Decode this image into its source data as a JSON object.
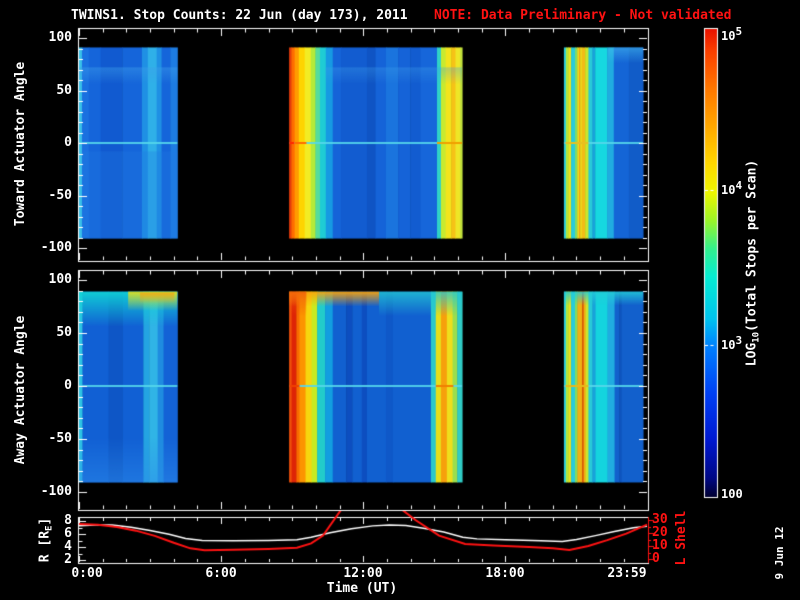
{
  "title": {
    "main": "TWINS1. Stop Counts: 22 Jun (day 173), 2011",
    "note": "NOTE: Data Preliminary - Not validated"
  },
  "stamp": "9 Jun 12",
  "colors": {
    "bg": "#000000",
    "axis": "#ffffff",
    "note_red": "#ff1212",
    "lshell_red": "#ff1212",
    "hline_cyan": "rgba(85,215,235,0.9)"
  },
  "axes": {
    "panel1_label": "Toward Actuator Angle",
    "panel2_label": "Away Actuator Angle",
    "r_label_pre": "R [R",
    "r_label_sub": "E",
    "r_label_post": "]",
    "lshell_label": "L Shell",
    "time_label": "Time (UT)",
    "panel_yticks": [
      "100",
      "50",
      "0",
      "-50",
      "-100"
    ],
    "r_ticks": [
      "8",
      "6",
      "4",
      "2"
    ],
    "l_ticks": [
      "30",
      "20",
      "10",
      "0"
    ],
    "x_ticks": [
      "0:00",
      "6:00",
      "12:00",
      "18:00",
      "23:59"
    ]
  },
  "colorbar": {
    "title_pre": "LOG",
    "title_sub": "10",
    "title_post": "(Total Stops per Scan)",
    "ticks": [
      {
        "base": "10",
        "exp": "5"
      },
      {
        "base": "10",
        "exp": "4"
      },
      {
        "base": "10",
        "exp": "3"
      },
      {
        "base": "100",
        "exp": ""
      }
    ],
    "gradient": [
      [
        0,
        "#e81000"
      ],
      [
        0.05,
        "#fb4000"
      ],
      [
        0.13,
        "#ff7800"
      ],
      [
        0.21,
        "#ffa800"
      ],
      [
        0.29,
        "#ffd800"
      ],
      [
        0.35,
        "#eef600"
      ],
      [
        0.41,
        "#9cf428"
      ],
      [
        0.47,
        "#34f08c"
      ],
      [
        0.53,
        "#06ecd2"
      ],
      [
        0.62,
        "#00c4ee"
      ],
      [
        0.68,
        "#0080ff"
      ],
      [
        0.78,
        "#0040f4"
      ],
      [
        0.88,
        "#0018d0"
      ],
      [
        0.96,
        "#000884"
      ],
      [
        1,
        "#000030"
      ]
    ]
  },
  "chart_data": [
    {
      "type": "heatmap",
      "name": "toward",
      "ylabel": "Toward Actuator Angle",
      "ylim": [
        -100,
        100
      ],
      "angle_coverage": [
        -91,
        91
      ],
      "xlim_hours": [
        0,
        23.983
      ],
      "segments": [
        {
          "t0": 0.0,
          "t1": 4.15,
          "stripes": [
            [
              0,
              0.03,
              "#38c0e8"
            ],
            [
              0.03,
              0.1,
              "#1a70e0"
            ],
            [
              0.1,
              0.22,
              "#1565da"
            ],
            [
              0.22,
              0.44,
              "#115ad0"
            ],
            [
              0.44,
              0.64,
              "#1565da"
            ],
            [
              0.64,
              0.7,
              "#1f90e4"
            ],
            [
              0.7,
              0.79,
              "#2fb0e8"
            ],
            [
              0.79,
              0.84,
              "#1f90e4"
            ],
            [
              0.84,
              0.93,
              "#1565da"
            ],
            [
              0.93,
              1,
              "#1d7ce2"
            ]
          ],
          "bands": [
            {
              "f0": 0,
              "f1": 1,
              "v0": 72,
              "v1": 56,
              "c0": "rgba(62,160,235,0.45)",
              "c1": "rgba(62,160,235,0)"
            },
            {
              "f0": 0.03,
              "f1": 1,
              "v0": -8,
              "v1": -91,
              "c0": "rgba(32,122,226,0.30)",
              "c1": "rgba(32,122,226,0.30)"
            }
          ],
          "hblips": []
        },
        {
          "t0": 8.87,
          "t1": 16.17,
          "stripes": [
            [
              0,
              0.013,
              "#e83c0c"
            ],
            [
              0.013,
              0.032,
              "#ff6c00"
            ],
            [
              0.032,
              0.056,
              "#ff9c00"
            ],
            [
              0.056,
              0.09,
              "#fed400"
            ],
            [
              0.09,
              0.125,
              "#f2ec24"
            ],
            [
              0.125,
              0.152,
              "#b5ea38"
            ],
            [
              0.152,
              0.178,
              "#55dc9c"
            ],
            [
              0.178,
              0.212,
              "#1fccd4"
            ],
            [
              0.212,
              0.252,
              "#169ae2"
            ],
            [
              0.252,
              0.3,
              "#1563d8"
            ],
            [
              0.3,
              0.45,
              "#125cd0"
            ],
            [
              0.45,
              0.5,
              "#0f54c4"
            ],
            [
              0.5,
              0.56,
              "#1563d8"
            ],
            [
              0.56,
              0.63,
              "#1a74de"
            ],
            [
              0.63,
              0.7,
              "#1563d8"
            ],
            [
              0.7,
              0.76,
              "#125cd0"
            ],
            [
              0.76,
              0.855,
              "#1666da"
            ],
            [
              0.855,
              0.878,
              "#30d2c6"
            ],
            [
              0.878,
              0.905,
              "#c6ea30"
            ],
            [
              0.905,
              0.938,
              "#f2e41c"
            ],
            [
              0.938,
              0.962,
              "#f6c217"
            ],
            [
              0.962,
              0.988,
              "#eee626"
            ],
            [
              0.988,
              1,
              "#c2e23c"
            ]
          ],
          "bands": [
            {
              "f0": 0.21,
              "f1": 1,
              "v0": 72,
              "v1": 56,
              "c0": "rgba(62,160,235,0.35)",
              "c1": "rgba(62,160,235,0)"
            }
          ],
          "hblips": [
            [
              0,
              0.03,
              "#ff2800"
            ],
            [
              0.03,
              0.1,
              "#ff6c00"
            ],
            [
              0.855,
              1,
              "#f0a000"
            ]
          ]
        },
        {
          "t0": 20.47,
          "t1": 23.81,
          "stripes": [
            [
              0,
              0.025,
              "#2ccede"
            ],
            [
              0.025,
              0.056,
              "#b2e83c"
            ],
            [
              0.056,
              0.09,
              "#ece420"
            ],
            [
              0.09,
              0.14,
              "#2accda"
            ],
            [
              0.14,
              0.168,
              "#7cdc6c"
            ],
            [
              0.168,
              0.19,
              "#eede1e"
            ],
            [
              0.19,
              0.205,
              "#f6a212"
            ],
            [
              0.205,
              0.225,
              "#eede1e"
            ],
            [
              0.225,
              0.268,
              "#f2bc16"
            ],
            [
              0.268,
              0.31,
              "#cce62c"
            ],
            [
              0.31,
              0.36,
              "#28cad8"
            ],
            [
              0.36,
              0.395,
              "#18a2da"
            ],
            [
              0.395,
              0.545,
              "#16d8e0"
            ],
            [
              0.545,
              0.63,
              "#20ace0"
            ],
            [
              0.63,
              0.82,
              "#1465d6"
            ],
            [
              0.82,
              1,
              "#115cc8"
            ]
          ],
          "bands": [
            {
              "f0": 0.56,
              "f1": 1,
              "v0": 91,
              "v1": 76,
              "c0": "rgba(70,190,240,0.55)",
              "c1": "rgba(70,190,240,0)"
            }
          ],
          "hblips": [
            [
              0.02,
              0.31,
              "#e8c020"
            ]
          ]
        }
      ]
    },
    {
      "type": "heatmap",
      "name": "away",
      "ylabel": "Away Actuator Angle",
      "ylim": [
        -100,
        100
      ],
      "angle_coverage": [
        -91,
        89
      ],
      "xlim_hours": [
        0,
        23.983
      ],
      "segments": [
        {
          "t0": 0.0,
          "t1": 4.15,
          "stripes": [
            [
              0,
              0.035,
              "#2cc4e4"
            ],
            [
              0.035,
              0.3,
              "#1160d4"
            ],
            [
              0.3,
              0.44,
              "#0e56c6"
            ],
            [
              0.44,
              0.655,
              "#1160d4"
            ],
            [
              0.655,
              0.715,
              "#24a4e2"
            ],
            [
              0.715,
              0.8,
              "#30b4e6"
            ],
            [
              0.8,
              0.86,
              "#1f8ce0"
            ],
            [
              0.86,
              1,
              "#1362d6"
            ]
          ],
          "bands": [
            {
              "f0": 0,
              "f1": 1,
              "v0": 89,
              "v1": 56,
              "c0": "rgba(16,210,214,0.95)",
              "c1": "rgba(16,210,214,0)"
            },
            {
              "f0": 0.5,
              "f1": 1,
              "v0": 89,
              "v1": 71,
              "c0": "rgba(232,222,25,0.92)",
              "c1": "rgba(232,222,25,0)"
            },
            {
              "f0": 0.62,
              "f1": 0.97,
              "v0": 88,
              "v1": 78,
              "c0": "rgba(248,160,15,0.75)",
              "c1": "rgba(248,160,15,0)"
            },
            {
              "f0": 0,
              "f1": 1,
              "v0": -48,
              "v1": -91,
              "c0": "rgba(45,140,235,0)",
              "c1": "rgba(45,140,235,0.5)"
            }
          ],
          "hblips": []
        },
        {
          "t0": 8.87,
          "t1": 16.17,
          "stripes": [
            [
              0,
              0.014,
              "#f0500a"
            ],
            [
              0.014,
              0.042,
              "#de2406"
            ],
            [
              0.042,
              0.06,
              "#f86c00"
            ],
            [
              0.06,
              0.095,
              "#fc9400"
            ],
            [
              0.095,
              0.13,
              "#f6d60e"
            ],
            [
              0.13,
              0.162,
              "#c8ea22"
            ],
            [
              0.162,
              0.208,
              "#22ccca"
            ],
            [
              0.208,
              0.252,
              "#129ee0"
            ],
            [
              0.252,
              0.33,
              "#1160d0"
            ],
            [
              0.33,
              0.365,
              "#0d4ec0"
            ],
            [
              0.365,
              0.42,
              "#1160d0"
            ],
            [
              0.42,
              0.45,
              "#0d4ec0"
            ],
            [
              0.45,
              0.56,
              "#1160d0"
            ],
            [
              0.56,
              0.6,
              "#0f58c8"
            ],
            [
              0.6,
              0.82,
              "#1160d0"
            ],
            [
              0.82,
              0.848,
              "#2ac8cc"
            ],
            [
              0.848,
              0.878,
              "#e6de1a"
            ],
            [
              0.878,
              0.912,
              "#f6a00c"
            ],
            [
              0.912,
              0.945,
              "#eede1c"
            ],
            [
              0.945,
              0.972,
              "#9ade4e"
            ],
            [
              0.972,
              1,
              "#30ccc6"
            ]
          ],
          "bands": [
            {
              "f0": 0,
              "f1": 0.52,
              "v0": 89,
              "v1": 75,
              "c0": "rgba(250,165,12,0.95)",
              "c1": "rgba(250,165,12,0)"
            },
            {
              "f0": 0,
              "f1": 0.1,
              "v0": 89,
              "v1": 66,
              "c0": "rgba(240,80,8,0.7)",
              "c1": "rgba(240,80,8,0)"
            },
            {
              "f0": 0.52,
              "f1": 1,
              "v0": 89,
              "v1": 66,
              "c0": "rgba(35,200,210,0.8)",
              "c1": "rgba(35,200,210,0)"
            }
          ],
          "hblips": [
            [
              0,
              0.06,
              "#f04000"
            ],
            [
              0.848,
              0.95,
              "#f08000"
            ]
          ]
        },
        {
          "t0": 20.47,
          "t1": 23.81,
          "stripes": [
            [
              0,
              0.025,
              "#2ccede"
            ],
            [
              0.025,
              0.056,
              "#b2e83c"
            ],
            [
              0.056,
              0.09,
              "#e8e020"
            ],
            [
              0.09,
              0.14,
              "#2accda"
            ],
            [
              0.14,
              0.17,
              "#84dc60"
            ],
            [
              0.17,
              0.23,
              "#f0b014"
            ],
            [
              0.23,
              0.25,
              "#e05808"
            ],
            [
              0.25,
              0.275,
              "#f0b014"
            ],
            [
              0.275,
              0.31,
              "#cce62c"
            ],
            [
              0.31,
              0.36,
              "#28cad8"
            ],
            [
              0.36,
              0.4,
              "#18a2da"
            ],
            [
              0.4,
              0.55,
              "#14d4de"
            ],
            [
              0.55,
              0.64,
              "#20ace0"
            ],
            [
              0.64,
              0.7,
              "#1260cc"
            ],
            [
              0.7,
              0.73,
              "#0e54be"
            ],
            [
              0.73,
              1,
              "#1260cc"
            ]
          ],
          "bands": [
            {
              "f0": 0,
              "f1": 1,
              "v0": 89,
              "v1": 76,
              "c0": "rgba(35,205,215,0.85)",
              "c1": "rgba(35,205,215,0)"
            }
          ],
          "hblips": [
            [
              0.02,
              0.31,
              "#e8b81a"
            ]
          ]
        }
      ]
    },
    {
      "type": "line",
      "name": "orbit",
      "xlabel": "Time (UT)",
      "xticks": [
        "0:00",
        "6:00",
        "12:00",
        "18:00",
        "23:59"
      ],
      "ylim_left": [
        2,
        8
      ],
      "ylim_right": [
        0,
        30
      ],
      "series": [
        {
          "name": "R [RE]",
          "color": "#ffffff",
          "axis": "left",
          "points": [
            [
              0,
              7.25
            ],
            [
              0.7,
              7.4
            ],
            [
              1.4,
              7.4
            ],
            [
              2.2,
              7.05
            ],
            [
              3,
              6.55
            ],
            [
              3.8,
              5.95
            ],
            [
              4.5,
              5.3
            ],
            [
              5.2,
              5.0
            ],
            [
              6.5,
              4.95
            ],
            [
              8,
              5.0
            ],
            [
              9.2,
              5.1
            ],
            [
              9.8,
              5.5
            ],
            [
              10.6,
              6.2
            ],
            [
              11.5,
              6.8
            ],
            [
              12.4,
              7.25
            ],
            [
              13.1,
              7.4
            ],
            [
              13.8,
              7.3
            ],
            [
              14.6,
              6.85
            ],
            [
              15.4,
              6.3
            ],
            [
              16.2,
              5.5
            ],
            [
              16.8,
              5.25
            ],
            [
              18,
              5.1
            ],
            [
              19.5,
              4.95
            ],
            [
              20.4,
              4.85
            ],
            [
              21,
              5.15
            ],
            [
              21.8,
              5.75
            ],
            [
              22.6,
              6.4
            ],
            [
              23.4,
              6.95
            ],
            [
              23.98,
              7.2
            ]
          ]
        },
        {
          "name": "L Shell",
          "color": "#ff1212",
          "axis": "right",
          "points": [
            [
              0,
              27
            ],
            [
              0.8,
              26.3
            ],
            [
              1.6,
              24.6
            ],
            [
              2.4,
              21.8
            ],
            [
              3.2,
              17.8
            ],
            [
              4,
              12.5
            ],
            [
              4.7,
              8.2
            ],
            [
              5.3,
              6.8
            ],
            [
              6.5,
              7.1
            ],
            [
              8,
              7.7
            ],
            [
              9.2,
              8.6
            ],
            [
              9.8,
              12
            ],
            [
              10.3,
              18
            ],
            [
              11.3,
              44
            ],
            [
              13.2,
              44
            ],
            [
              14.2,
              30
            ],
            [
              15.2,
              18
            ],
            [
              16.3,
              11.5
            ],
            [
              17.5,
              10.3
            ],
            [
              19,
              9.2
            ],
            [
              20,
              8.2
            ],
            [
              20.7,
              6.9
            ],
            [
              21.5,
              10
            ],
            [
              22.3,
              14.5
            ],
            [
              23.1,
              19.5
            ],
            [
              23.98,
              26.5
            ]
          ]
        }
      ]
    }
  ]
}
